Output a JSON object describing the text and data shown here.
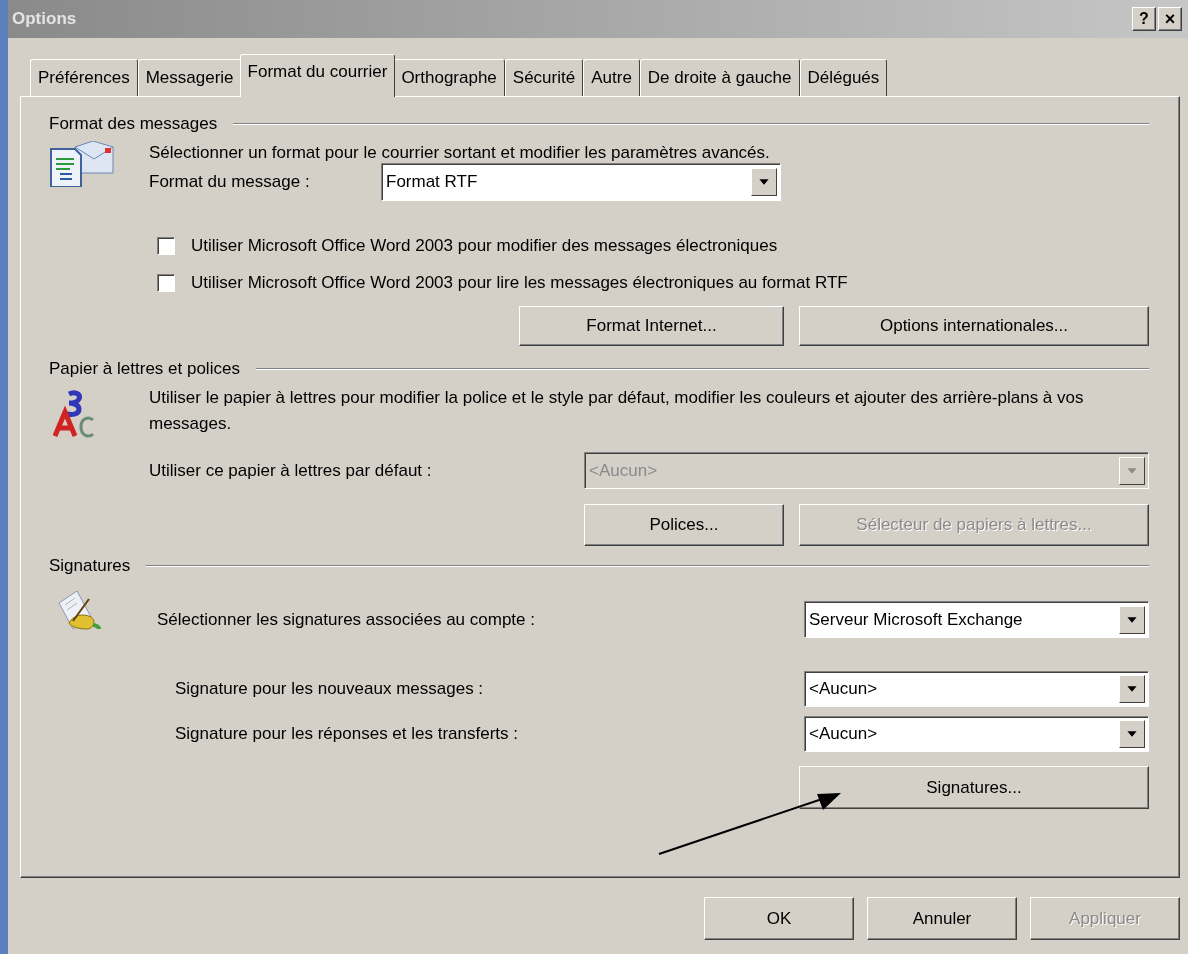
{
  "window": {
    "title": "Options",
    "help_button": "?",
    "close_button": "×"
  },
  "tabs": [
    {
      "label": "Préférences",
      "selected": false
    },
    {
      "label": "Messagerie",
      "selected": false
    },
    {
      "label": "Format du courrier",
      "selected": true
    },
    {
      "label": "Orthographe",
      "selected": false
    },
    {
      "label": "Sécurité",
      "selected": false
    },
    {
      "label": "Autre",
      "selected": false
    },
    {
      "label": "De droite à gauche",
      "selected": false
    },
    {
      "label": "Délégués",
      "selected": false
    }
  ],
  "message_format": {
    "title": "Format des messages",
    "description": "Sélectionner un format pour le courrier sortant et modifier les paramètres avancés.",
    "format_label": "Format du message :",
    "format_value": "Format RTF",
    "checkboxes": [
      {
        "label": "Utiliser Microsoft Office Word 2003 pour modifier des messages électroniques",
        "checked": false
      },
      {
        "label": "Utiliser Microsoft Office Word 2003 pour lire les messages électroniques au format RTF",
        "checked": false
      }
    ],
    "buttons": [
      {
        "label": "Format Internet...",
        "disabled": false
      },
      {
        "label": "Options internationales...",
        "disabled": false
      }
    ]
  },
  "stationery": {
    "title": "Papier à lettres et polices",
    "description": "Utiliser le papier à lettres pour modifier la police et le style par défaut, modifier les couleurs et ajouter des arrière-plans à vos messages.",
    "default_label": "Utiliser ce papier à lettres par défaut :",
    "default_value": "<Aucun>",
    "default_disabled": true,
    "buttons": [
      {
        "label": "Polices...",
        "disabled": false
      },
      {
        "label": "Sélecteur de papiers à lettres...",
        "disabled": true
      }
    ]
  },
  "signatures": {
    "title": "Signatures",
    "account_label": "Sélectionner les signatures associées au compte :",
    "account_value": "Serveur Microsoft Exchange",
    "new_label": "Signature pour les nouveaux messages :",
    "new_value": "<Aucun>",
    "reply_label": "Signature pour les réponses et les transferts :",
    "reply_value": "<Aucun>",
    "button": "Signatures..."
  },
  "footer_buttons": [
    {
      "label": "OK",
      "disabled": false
    },
    {
      "label": "Annuler",
      "disabled": false
    },
    {
      "label": "Appliquer",
      "disabled": true
    }
  ]
}
